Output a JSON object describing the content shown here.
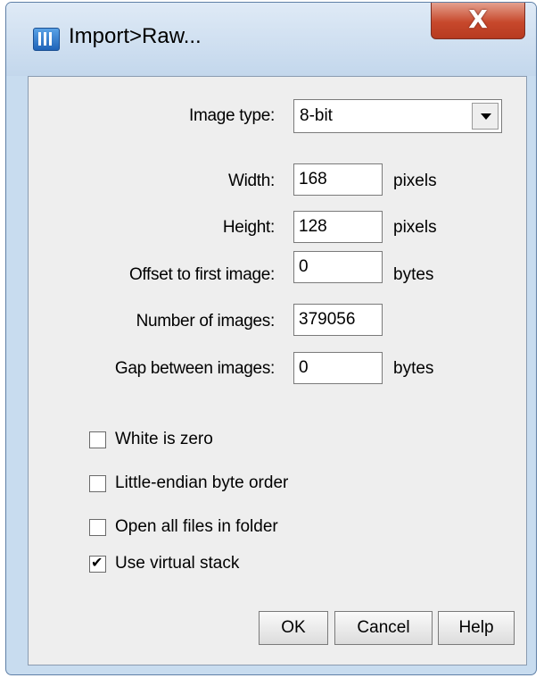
{
  "window": {
    "title": "Import>Raw...",
    "close_glyph": "X",
    "icon": "imagej-app-icon"
  },
  "form": {
    "image_type": {
      "label": "Image type:",
      "value": "8-bit"
    },
    "width": {
      "label": "Width:",
      "value": "168",
      "unit": "pixels"
    },
    "height": {
      "label": "Height:",
      "value": "128",
      "unit": "pixels"
    },
    "offset": {
      "label": "Offset to first image:",
      "value": "0",
      "unit": "bytes"
    },
    "number_of_images": {
      "label": "Number of images:",
      "value": "379056"
    },
    "gap": {
      "label": "Gap between images:",
      "value": "0",
      "unit": "bytes"
    }
  },
  "options": [
    {
      "label": "White is zero",
      "checked": false
    },
    {
      "label": "Little-endian byte order",
      "checked": false
    },
    {
      "label": "Open all files in folder",
      "checked": false
    },
    {
      "label": "Use virtual stack",
      "checked": true
    }
  ],
  "buttons": {
    "ok": "OK",
    "cancel": "Cancel",
    "help": "Help"
  },
  "checkmark_glyph": "✔",
  "colors": {
    "close_red": "#c7482c",
    "frame_blue": "#c8dcef",
    "client_gray": "#eeeeee"
  }
}
